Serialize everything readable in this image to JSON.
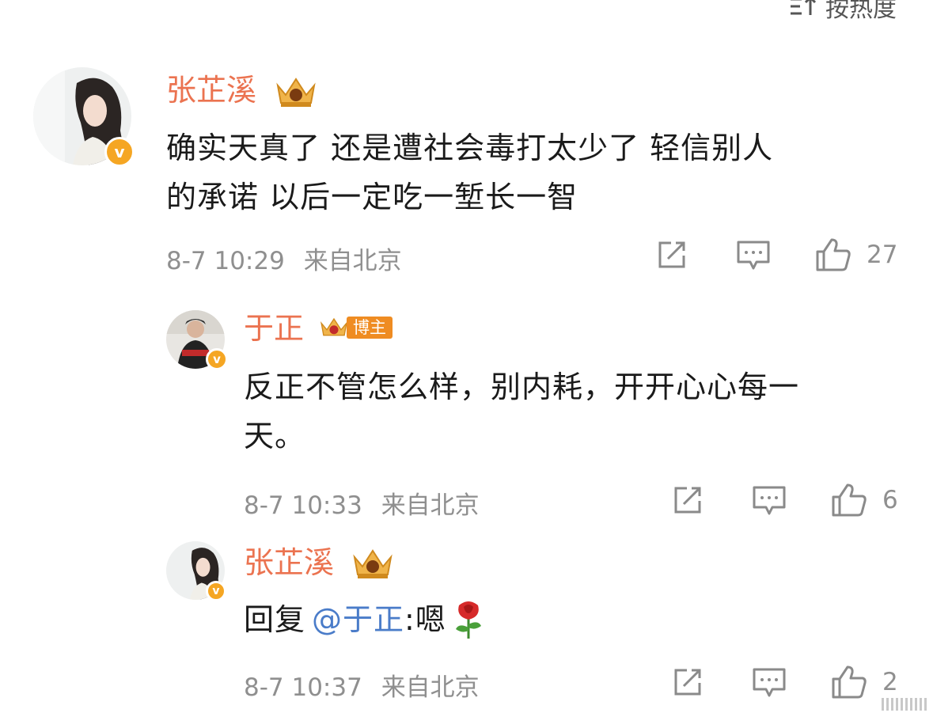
{
  "sort": {
    "label": "按热度"
  },
  "comments": [
    {
      "user": "张芷溪",
      "text_line1": "确实天真了 还是遭社会毒打太少了 轻信别人",
      "text_line2": "的承诺 以后一定吃一堑长一智",
      "time": "8-7 10:29",
      "location": "来自北京",
      "likes": "27"
    },
    {
      "user": "于正",
      "badge_label": "博主",
      "text_line1": "反正不管怎么样，别内耗，开开心心每一",
      "text_line2": "天。",
      "time": "8-7 10:33",
      "location": "来自北京",
      "likes": "6"
    },
    {
      "user": "张芷溪",
      "reply_prefix": "回复",
      "mention": "@于正",
      "reply_text": ":嗯",
      "time": "8-7 10:37",
      "location": "来自北京",
      "likes": "2"
    }
  ],
  "colors": {
    "name": "#eb7350",
    "meta": "#8f8f8f",
    "mention": "#4a7cc9",
    "verified": "#f5a623"
  },
  "icons": [
    "sort-icon",
    "crown-badge-icon",
    "verified-icon",
    "share-icon",
    "comment-icon",
    "like-icon",
    "rose-icon"
  ]
}
